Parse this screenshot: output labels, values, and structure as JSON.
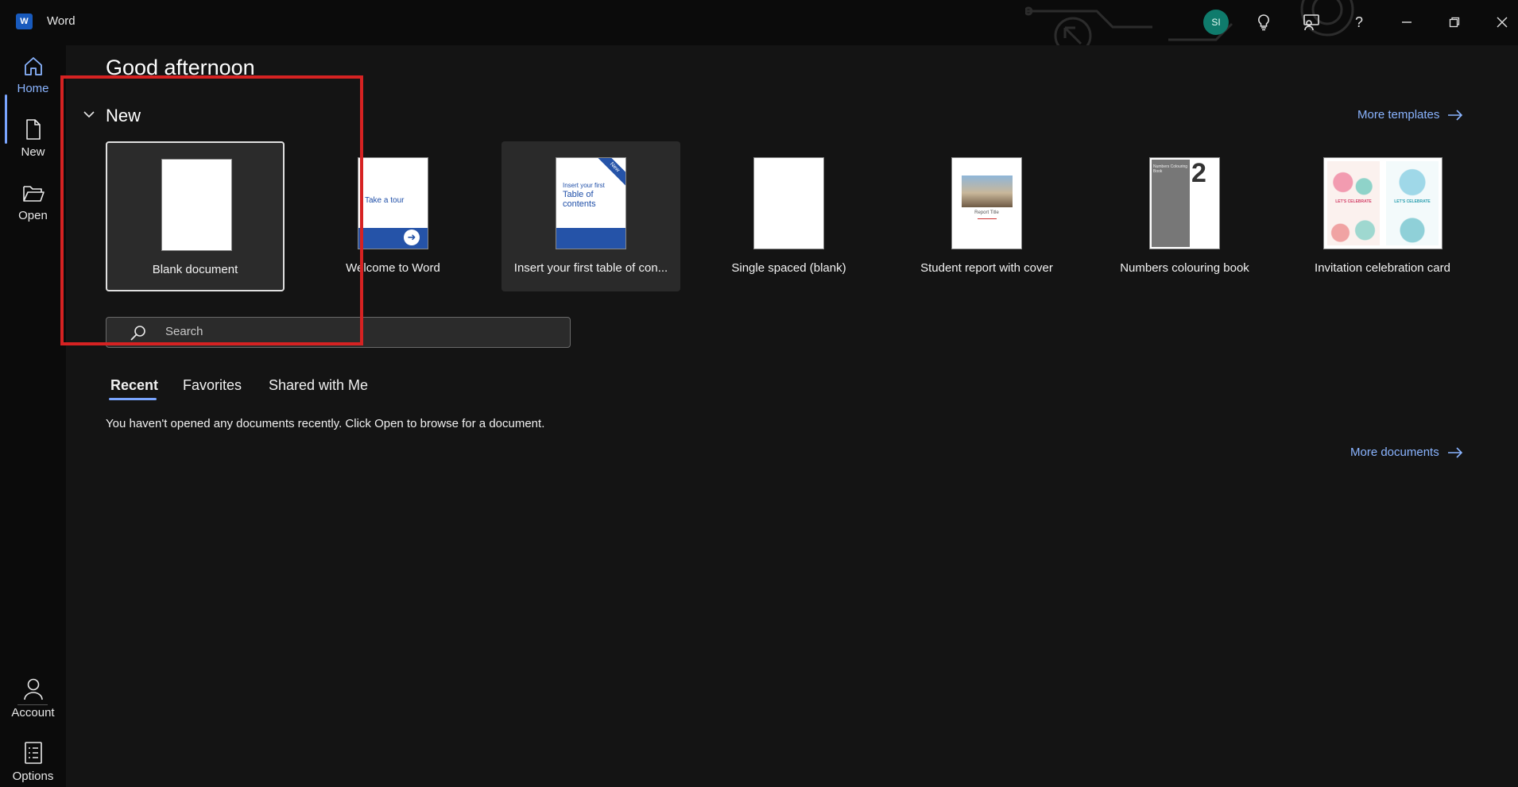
{
  "titlebar": {
    "app_name": "Word",
    "logo_letter": "W",
    "user_initials": "SI",
    "help_label": "?"
  },
  "rail": {
    "items": [
      {
        "label": "Home",
        "icon": "home-icon",
        "active": true
      },
      {
        "label": "New",
        "icon": "new-document-icon"
      },
      {
        "label": "Open",
        "icon": "folder-open-icon"
      }
    ],
    "bottom_items": [
      {
        "label": "Account",
        "icon": "person-icon"
      },
      {
        "label": "Options",
        "icon": "options-icon"
      }
    ]
  },
  "main": {
    "greeting": "Good afternoon",
    "new_section_title": "New",
    "more_templates": "More templates",
    "templates": [
      {
        "label": "Blank document",
        "state": "selected"
      },
      {
        "label": "Welcome to Word",
        "thumb_text": "Take a tour"
      },
      {
        "label": "Insert your first table of con...",
        "thumb_small": "Insert your first",
        "thumb_big": "Table of contents",
        "badge": "New",
        "state": "hover"
      },
      {
        "label": "Single spaced (blank)"
      },
      {
        "label": "Student report with cover",
        "thumb_text": "Report Title"
      },
      {
        "label": "Numbers colouring book",
        "thumb_text": "Numbers Colouring Book",
        "thumb_number": "2"
      },
      {
        "label": "Invitation celebration card",
        "thumb_text": "LET'S CELEBRATE"
      }
    ],
    "search": {
      "placeholder": "Search",
      "value": ""
    },
    "tabs": [
      {
        "label": "Recent",
        "active": true
      },
      {
        "label": "Favorites"
      },
      {
        "label": "Shared with Me"
      }
    ],
    "empty_message": "You haven't opened any documents recently. Click Open to browse for a document.",
    "more_documents": "More documents"
  },
  "colors": {
    "accent_link": "#8ab4ff",
    "word_blue": "#185abd",
    "avatar_bg": "#0f7b6c",
    "annotation_red": "#d62222"
  }
}
